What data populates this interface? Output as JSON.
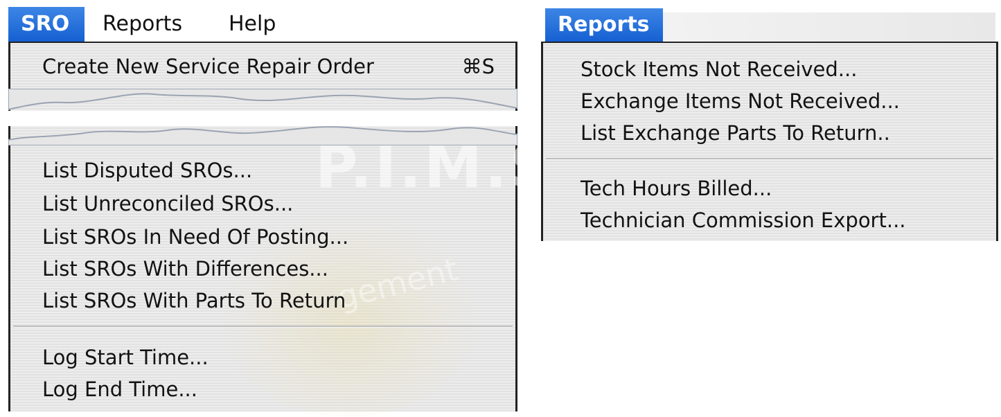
{
  "left_menubar": {
    "items": [
      {
        "label": "SRO",
        "active": true
      },
      {
        "label": "Reports",
        "active": false
      },
      {
        "label": "Help",
        "active": false
      }
    ]
  },
  "sro_menu": {
    "top_item": {
      "label": "Create New Service Repair Order",
      "shortcut": "⌘S"
    },
    "items_group1": [
      "List Disputed SROs...",
      "List Unreconciled SROs...",
      "List SROs In Need Of Posting...",
      "List SROs With Differences...",
      "List SROs With Parts To Return"
    ],
    "items_group2": [
      "Log Start Time...",
      "Log End Time..."
    ],
    "watermark": "P.I.M.S",
    "watermark_sub": "gement"
  },
  "reports_menu": {
    "title": "Reports",
    "items_group1": [
      "Stock Items Not Received...",
      "Exchange Items Not Received...",
      "List Exchange Parts To Return.."
    ],
    "items_group2": [
      "Tech Hours Billed...",
      "Technician Commission Export..."
    ]
  },
  "colors": {
    "accent": "#1f6fdc",
    "menu_bg": "#e8e8e8"
  }
}
